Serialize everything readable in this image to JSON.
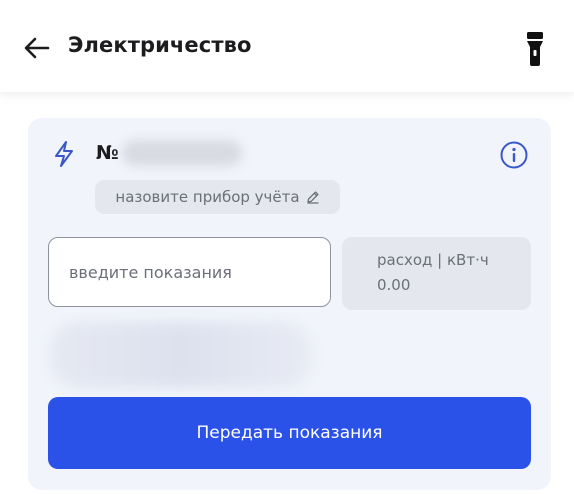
{
  "header": {
    "title": "Электричество",
    "back_icon": "arrow-left-icon",
    "flashlight_icon": "flashlight-icon"
  },
  "meter": {
    "number_prefix": "№",
    "name_placeholder": "назовите прибор учёта",
    "edit_icon": "pencil-icon",
    "type_icon": "lightning-bolt-icon",
    "info_icon": "info-icon"
  },
  "reading": {
    "input_value": "",
    "input_placeholder": "введите показания"
  },
  "consumption": {
    "label": "расход | кВт·ч",
    "value": "0.00"
  },
  "actions": {
    "submit_label": "Передать показания"
  },
  "colors": {
    "accent": "#2b52e8",
    "icon_blue": "#3a57c9",
    "card_bg": "#f1f4fb",
    "annotation_arrow": "#22b345"
  }
}
